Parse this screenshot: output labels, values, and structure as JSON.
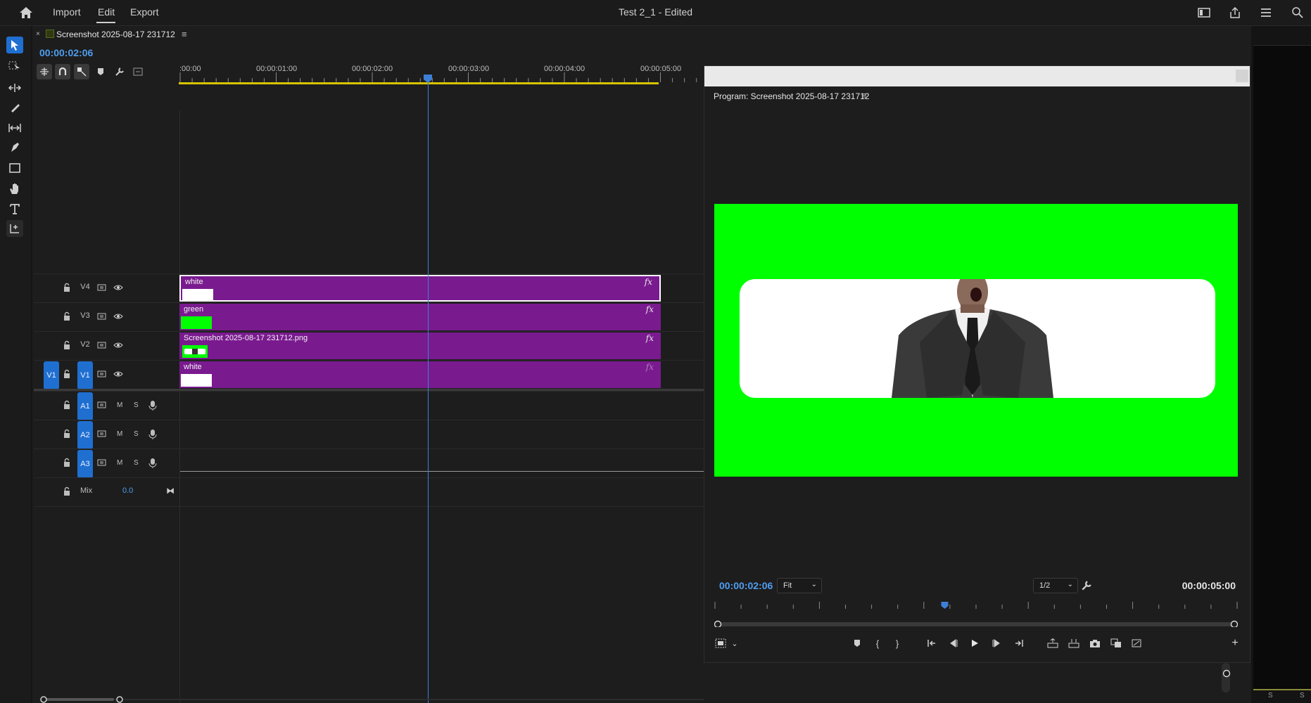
{
  "topbar": {
    "menu": [
      "Import",
      "Edit",
      "Export"
    ],
    "active_menu": "Edit",
    "title": "Test 2_1 - Edited"
  },
  "timeline": {
    "sequence_tab": "Screenshot 2025-08-17 231712",
    "timecode": "00:00:02:06",
    "ruler_labels": [
      ":00:00",
      "00:00:01:00",
      "00:00:02:00",
      "00:00:03:00",
      "00:00:04:00",
      "00:00:05:00"
    ],
    "video_tracks": [
      {
        "label": "V4",
        "clip": "white",
        "thumb": "white"
      },
      {
        "label": "V3",
        "clip": "green",
        "thumb": "green"
      },
      {
        "label": "V2",
        "clip": "Screenshot 2025-08-17 231712.png",
        "thumb": "screenshot"
      },
      {
        "label": "V1",
        "clip": "white",
        "thumb": "white",
        "source_patch": "V1"
      }
    ],
    "audio_tracks": [
      {
        "label": "A1",
        "m": "M",
        "s": "S"
      },
      {
        "label": "A2",
        "m": "M",
        "s": "S"
      },
      {
        "label": "A3",
        "m": "M",
        "s": "S"
      }
    ],
    "mix": {
      "label": "Mix",
      "value": "0.0"
    },
    "fx_label": "fx"
  },
  "program": {
    "title": "Program: Screenshot 2025-08-17 231712",
    "timecode": "00:00:02:06",
    "duration": "00:00:05:00",
    "zoom": "Fit",
    "resolution": "1/2",
    "playhead_fraction": 0.44
  },
  "colors": {
    "accent": "#4f9ef0",
    "clip": "#7a1a8f",
    "chroma_green": "#00ff00",
    "work_area": "#d7c400"
  },
  "right_panel": {
    "labels": [
      "S",
      "S"
    ]
  }
}
